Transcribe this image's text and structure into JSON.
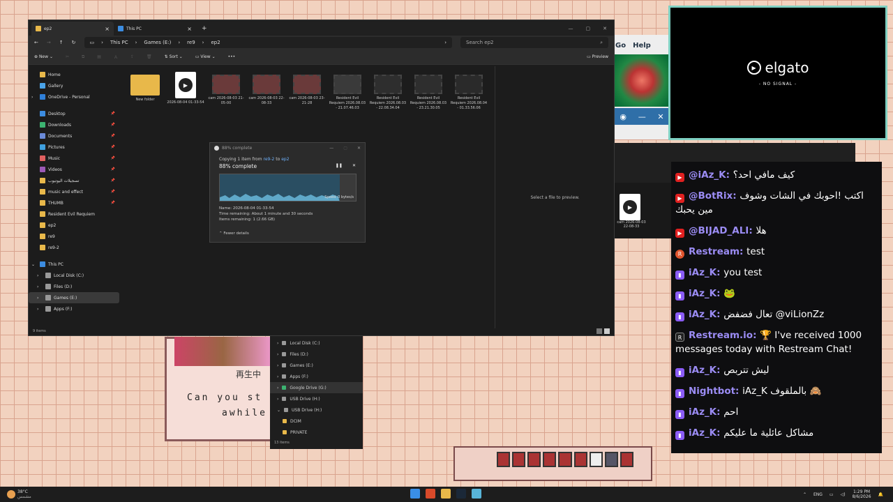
{
  "game": {
    "line1": "Can you st",
    "line2": "awhile",
    "kanji": "再生中"
  },
  "emu": {
    "menu": [
      "Go",
      "Help"
    ]
  },
  "explorer": {
    "tabs": [
      {
        "label": "ep2"
      },
      {
        "label": "This PC"
      }
    ],
    "breadcrumb": [
      "This PC",
      "Games (E:)",
      "re9",
      "ep2"
    ],
    "search_placeholder": "Search ep2",
    "commands": {
      "new": "New",
      "sort": "Sort",
      "view": "View",
      "more": "•••",
      "preview": "Preview"
    },
    "nav": [
      {
        "label": "Home",
        "color": "#e8b84a"
      },
      {
        "label": "Gallery",
        "color": "#4aa3e8"
      },
      {
        "label": "OneDrive - Personal",
        "color": "#2f7fd8"
      },
      {
        "label": "Desktop",
        "color": "#3c8ce0",
        "pin": "📌"
      },
      {
        "label": "Downloads",
        "color": "#3cb371",
        "pin": "📌"
      },
      {
        "label": "Documents",
        "color": "#6a8ad8",
        "pin": "📌"
      },
      {
        "label": "Pictures",
        "color": "#3fa0e0",
        "pin": "📌"
      },
      {
        "label": "Music",
        "color": "#e06060",
        "pin": "📌"
      },
      {
        "label": "Videos",
        "color": "#9b59b6",
        "pin": "📌"
      },
      {
        "label": "تسجيلات اليوتيوب",
        "color": "#e8b84a",
        "pin": "📌"
      },
      {
        "label": "music and effect",
        "color": "#e8b84a",
        "pin": "📌"
      },
      {
        "label": "THUMB",
        "color": "#e8b84a",
        "pin": "📌"
      },
      {
        "label": "Resident Evil Requiem",
        "color": "#e8b84a"
      },
      {
        "label": "ep2",
        "color": "#e8b84a"
      },
      {
        "label": "re9",
        "color": "#e8b84a"
      },
      {
        "label": "re9-2",
        "color": "#e8b84a"
      },
      {
        "label": "This PC",
        "color": "#3c8ce0"
      },
      {
        "label": "Local Disk (C:)",
        "color": "#999"
      },
      {
        "label": "Files (D:)",
        "color": "#999"
      },
      {
        "label": "Games (E:)",
        "color": "#999"
      },
      {
        "label": "Apps (F:)",
        "color": "#999"
      }
    ],
    "files": [
      {
        "type": "folder",
        "name": "New folder"
      },
      {
        "type": "mp4",
        "name": "2026-08-04 01-33-54"
      },
      {
        "type": "thumb",
        "name": "cam 2026-08-03 21-05-00",
        "tone": "#6a3a3a"
      },
      {
        "type": "thumb",
        "name": "cam 2026-08-03 22-08-33",
        "tone": "#6a3a3a"
      },
      {
        "type": "thumb",
        "name": "cam 2026-08-03 23-21-28",
        "tone": "#6a3a3a"
      },
      {
        "type": "thumb",
        "name": "Resident Evil Requiem 2026.08.03 - 21.07.46.03",
        "tone": "#3a3a3a"
      },
      {
        "type": "thumb",
        "name": "Resident Evil Requiem 2026.08.03 - 22.08.34.04",
        "tone": "#2e2e2e"
      },
      {
        "type": "thumb",
        "name": "Resident Evil Requiem 2026.08.03 - 23.21.30.05",
        "tone": "#2e2e2e"
      },
      {
        "type": "thumb",
        "name": "Resident Evil Requiem 2026.08.04 - 01.33.56.06",
        "tone": "#2a2a2a"
      }
    ],
    "preview_text": "Select a file to preview.",
    "status": "9 items"
  },
  "copy_dialog": {
    "title": "88% complete",
    "copying": "Copying 1 item from",
    "from": "re9-2",
    "to_word": "to",
    "dest": "ep2",
    "percent_text": "88% complete",
    "progress": 0.88,
    "speed": "Speed: 0 bytes/s",
    "name": "Name: 2026-08-04 01-33-54",
    "time": "Time remaining: About 1 minute and 30 seconds",
    "items": "Items remaining: 1 (2.66 GB)",
    "fewer": "Fewer details"
  },
  "explorer2": {
    "file_name": "cam 2026-08-03 22-08-33",
    "tree": [
      "Local Disk (C:)",
      "Files (D:)",
      "Games (E:)",
      "Apps (F:)",
      "Google Drive (G:)",
      "USB Drive (H:)",
      "USB Drive (H:)",
      "DCIM",
      "PRIVATE"
    ],
    "status": "13 items"
  },
  "elgato": {
    "logo": "elgato",
    "sub": "- NO SIGNAL -"
  },
  "chat": [
    {
      "platform": "yt",
      "user": "@iAz_K",
      "text": "كيف مافي احد؟"
    },
    {
      "platform": "yt",
      "user": "@BotRix",
      "text": "اكتب !احوبك في الشات وشوف مين يحبك"
    },
    {
      "platform": "yt",
      "user": "@BIJAD_ALI",
      "text": "هلا"
    },
    {
      "platform": "rs",
      "user": "Restream",
      "text": "test"
    },
    {
      "platform": "tw",
      "user": "iAz_K",
      "text": "you test"
    },
    {
      "platform": "tw",
      "user": "iAz_K",
      "text": "🐸"
    },
    {
      "platform": "tw",
      "user": "iAz_K",
      "text": "تعال فضفض @viLionZz"
    },
    {
      "platform": "ri",
      "user": "Restream.io",
      "text": "🏆 I've received 1000 messages today with Restream Chat!"
    },
    {
      "platform": "tw",
      "user": "iAz_K",
      "text": "ليش تتربص"
    },
    {
      "platform": "tw",
      "user": "Nightbot",
      "text": "iAz_K بالملقوف 🙈"
    },
    {
      "platform": "tw",
      "user": "iAz_K",
      "text": "احم"
    },
    {
      "platform": "tw",
      "user": "iAz_K",
      "text": "مشاكل عائلية ما عليكم"
    }
  ],
  "taskbar": {
    "temp": "38°C",
    "weather": "مشمس",
    "lang": "ENG",
    "time": "1:29 PM",
    "date": "8/6/2026"
  }
}
